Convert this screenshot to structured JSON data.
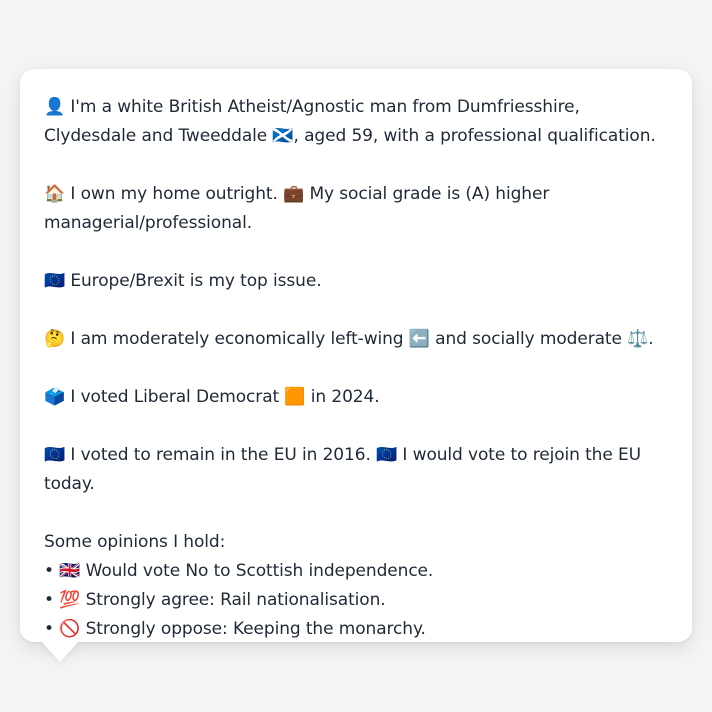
{
  "profile": {
    "line1": "👤 I'm a white British Atheist/Agnostic man from Dumfriesshire, Clydesdale and Tweeddale 🏴󠁧󠁢󠁳󠁣󠁴󠁿, aged 59, with a professional qualification.",
    "line2": "🏠 I own my home outright. 💼 My social grade is (A) higher managerial/professional.",
    "line3": "🇪🇺 Europe/Brexit is my top issue.",
    "line4": "🤔 I am moderately economically left-wing ⬅️ and socially moderate ⚖️.",
    "line5": "🗳️ I voted Liberal Democrat 🟧 in 2024.",
    "line6": "🇪🇺 I voted to remain in the EU in 2016. 🇪🇺 I would vote to rejoin the EU today.",
    "opinions_heading": "Some opinions I hold:",
    "opinions": [
      "• 🇬🇧 Would vote No to Scottish independence.",
      "• 💯 Strongly agree: Rail nationalisation.",
      "• 🚫 Strongly oppose: Keeping the monarchy."
    ]
  }
}
